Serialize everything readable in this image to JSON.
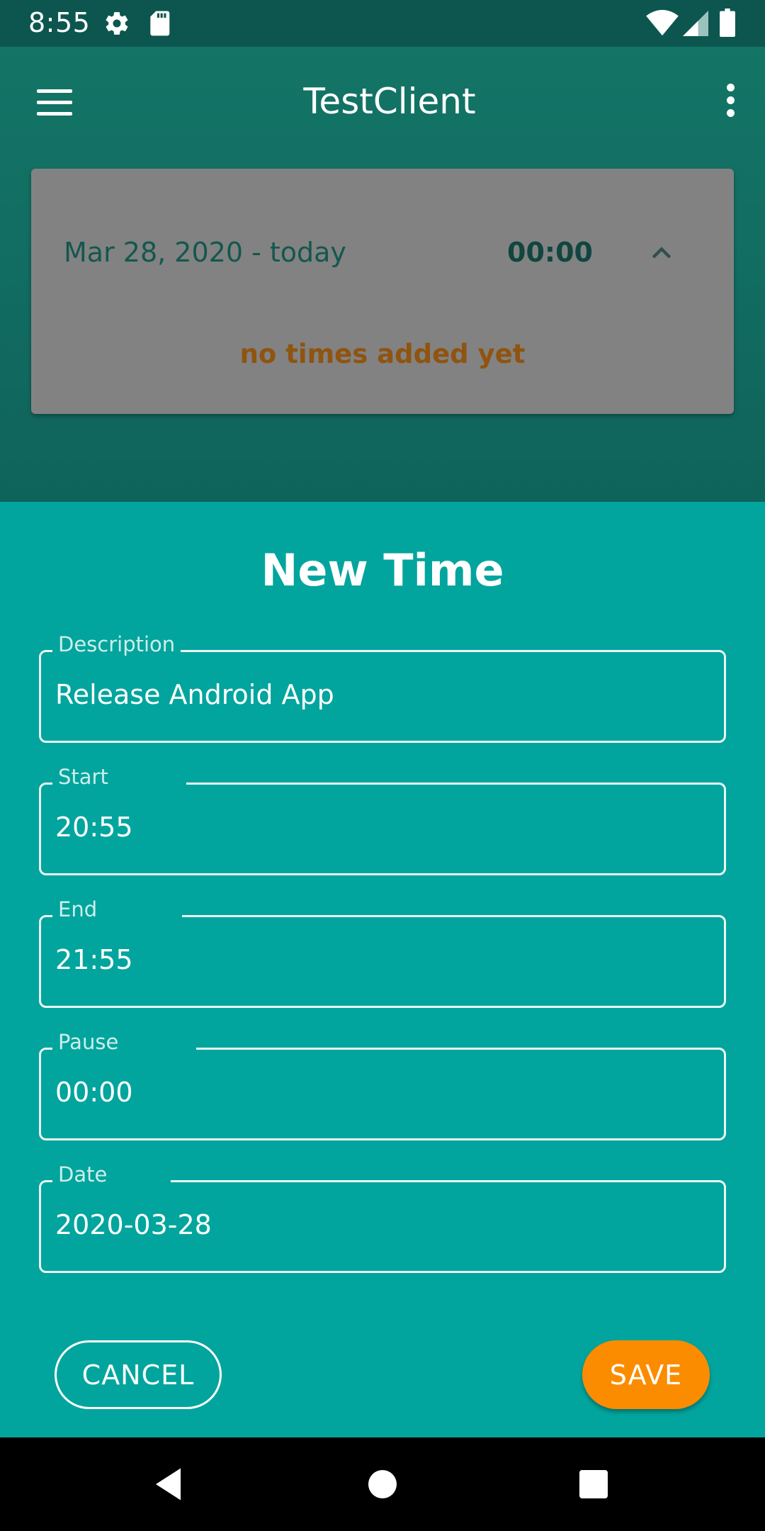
{
  "status_bar": {
    "time": "8:55",
    "icons": [
      "settings-icon",
      "sd-card-icon",
      "wifi-icon",
      "signal-icon",
      "battery-icon"
    ]
  },
  "app_bar": {
    "title": "TestClient",
    "menu_icon": "hamburger-menu-icon",
    "overflow_icon": "more-vert-icon"
  },
  "summary_card": {
    "date_range": "Mar 28, 2020 - today",
    "total": "00:00",
    "empty_message": "no times added yet"
  },
  "sheet": {
    "title": "New Time",
    "fields": [
      {
        "label": "Description",
        "value": "Release Android App"
      },
      {
        "label": "Start",
        "value": "20:55"
      },
      {
        "label": "End",
        "value": "21:55"
      },
      {
        "label": "Pause",
        "value": "00:00"
      },
      {
        "label": "Date",
        "value": "2020-03-28"
      }
    ],
    "cancel_label": "CANCEL",
    "save_label": "SAVE"
  },
  "colors": {
    "status_bar": "#0d5650",
    "app_bg": "#137566",
    "sheet": "#02a59d",
    "card": "#828282",
    "accent": "#fb8c00",
    "empty_text": "#8f5410"
  }
}
